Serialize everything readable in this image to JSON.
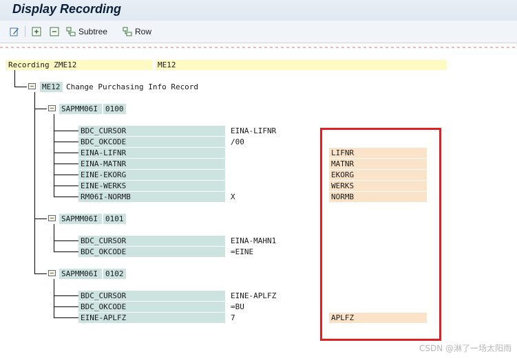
{
  "title": "Display Recording",
  "toolbar": {
    "subtree_label": "Subtree",
    "row_label": "Row"
  },
  "recording": {
    "label": "Recording ZME12",
    "value": "ME12"
  },
  "transaction": {
    "code": "ME12",
    "description": "Change Purchasing Info Record"
  },
  "screens": [
    {
      "program": "SAPMM06I",
      "dynpro": "0100",
      "fields": [
        {
          "name": "BDC_CURSOR",
          "value": "EINA-LIFNR",
          "var": ""
        },
        {
          "name": "BDC_OKCODE",
          "value": "/00",
          "var": ""
        },
        {
          "name": "EINA-LIFNR",
          "value": "",
          "var": "LIFNR"
        },
        {
          "name": "EINA-MATNR",
          "value": "",
          "var": "MATNR"
        },
        {
          "name": "EINE-EKORG",
          "value": "",
          "var": "EKORG"
        },
        {
          "name": "EINE-WERKS",
          "value": "",
          "var": "WERKS"
        },
        {
          "name": "RM06I-NORMB",
          "value": "X",
          "var": "NORMB"
        }
      ]
    },
    {
      "program": "SAPMM06I",
      "dynpro": "0101",
      "fields": [
        {
          "name": "BDC_CURSOR",
          "value": "EINA-MAHN1",
          "var": ""
        },
        {
          "name": "BDC_OKCODE",
          "value": "=EINE",
          "var": ""
        }
      ]
    },
    {
      "program": "SAPMM06I",
      "dynpro": "0102",
      "fields": [
        {
          "name": "BDC_CURSOR",
          "value": "EINE-APLFZ",
          "var": ""
        },
        {
          "name": "BDC_OKCODE",
          "value": "=BU",
          "var": ""
        },
        {
          "name": "EINE-APLFZ",
          "value": "7",
          "var": "APLFZ"
        }
      ]
    }
  ],
  "watermark": "CSDN @淋了一场太阳雨",
  "colors": {
    "highlight_box": "#e02020",
    "recording_row": "#fff9c4",
    "field_name": "#cde3e0",
    "variable": "#fbe3c9"
  },
  "icons": [
    "change-mode-icon",
    "expand-icon",
    "collapse-icon",
    "subtree-icon",
    "row-icon",
    "folder-node-icon"
  ]
}
